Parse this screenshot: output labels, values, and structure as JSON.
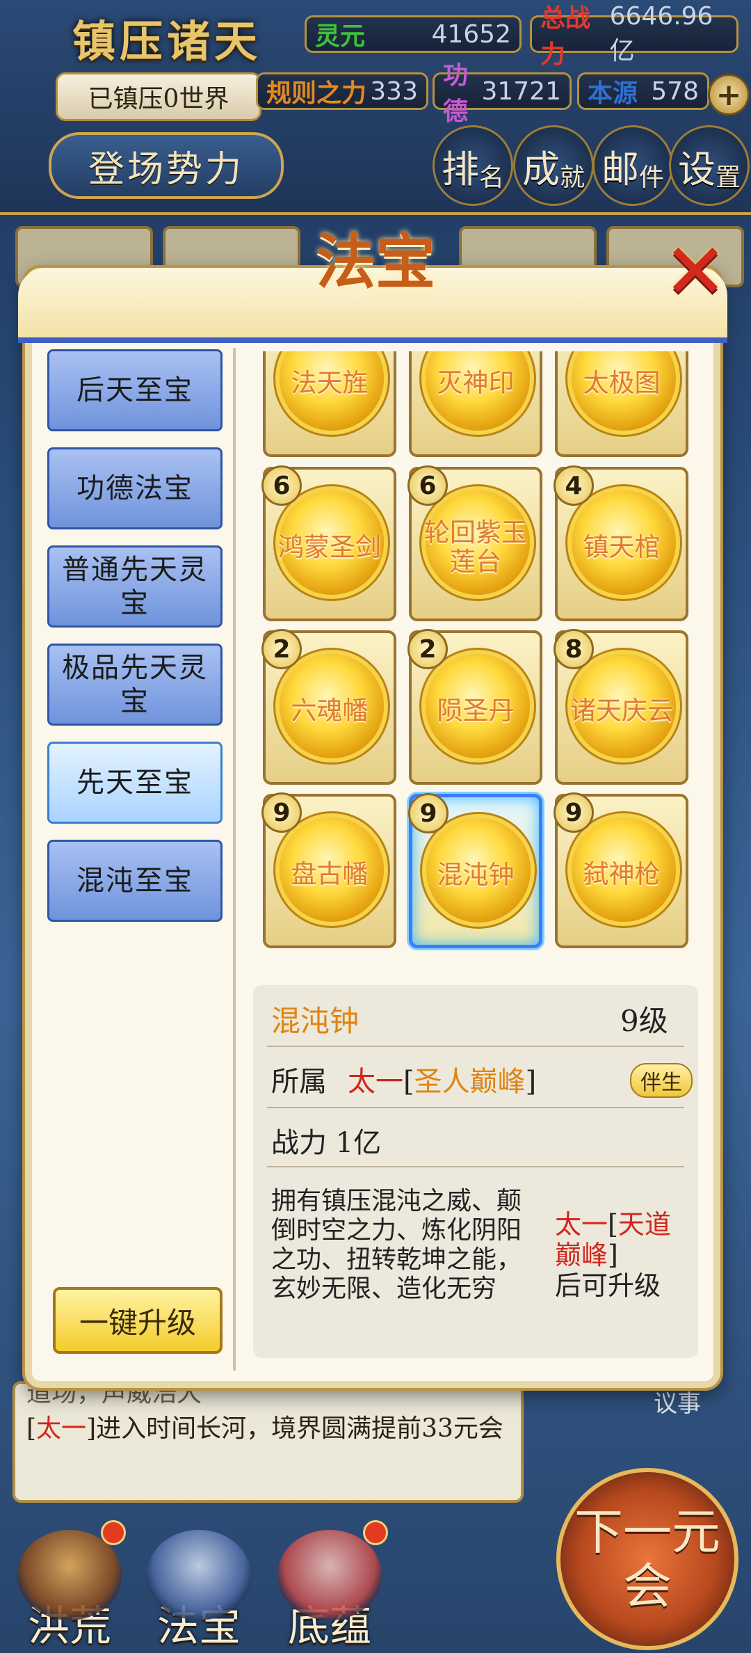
{
  "hud": {
    "title": "镇压诸天",
    "subtitle": "已镇压0世界",
    "faction_button": "登场势力",
    "resources": [
      {
        "label": "灵元",
        "value": "41652",
        "color": "#3fbf3f"
      },
      {
        "label": "总战力",
        "value": "6646.96亿",
        "color": "#e03a2a"
      },
      {
        "label": "规则之力",
        "value": "333",
        "color": "#e58a1f"
      },
      {
        "label": "功德",
        "value": "31721",
        "color": "#c85ad2"
      },
      {
        "label": "本源",
        "value": "578",
        "color": "#2f6fd8"
      }
    ],
    "plus": "+",
    "buttons": [
      {
        "main": "排",
        "sub": "名"
      },
      {
        "main": "成",
        "sub": "就"
      },
      {
        "main": "邮",
        "sub": "件"
      },
      {
        "main": "设",
        "sub": "置"
      }
    ]
  },
  "dialog": {
    "title": "法宝",
    "close": "✕",
    "categories": [
      "后天至宝",
      "功德法宝",
      "普通先天灵宝",
      "极品先天灵宝",
      "先天至宝",
      "混沌至宝"
    ],
    "active_category": "先天至宝",
    "one_key_upgrade": "一键升级",
    "treasures": [
      {
        "name": "法天旌",
        "level": null
      },
      {
        "name": "灭神印",
        "level": null
      },
      {
        "name": "太极图",
        "level": null
      },
      {
        "name": "鸿蒙圣剑",
        "level": "6"
      },
      {
        "name": "轮回紫玉莲台",
        "level": "6"
      },
      {
        "name": "镇天棺",
        "level": "4"
      },
      {
        "name": "六魂幡",
        "level": "2"
      },
      {
        "name": "陨圣丹",
        "level": "2"
      },
      {
        "name": "诸天庆云",
        "level": "8"
      },
      {
        "name": "盘古幡",
        "level": "9"
      },
      {
        "name": "混沌钟",
        "level": "9"
      },
      {
        "name": "弑神枪",
        "level": "9"
      }
    ],
    "selected": {
      "name": "混沌钟",
      "level": "9级",
      "belong_label": "所属",
      "owner": "太一",
      "owner_rank": "圣人巅峰",
      "bond_tag": "伴生",
      "power_label": "战力",
      "power": "1亿",
      "description": "拥有镇压混沌之威、颠倒时空之力、炼化阴阳之功、扭转乾坤之能，玄妙无限、造化无穷",
      "req_owner": "太一",
      "req_rank": "天道巅峰",
      "req_suffix": "后可升级"
    }
  },
  "log": {
    "line_partial": "道场，声威浩大",
    "owner": "太一",
    "line_text": "进入时间长河，境界圆满提前33元会"
  },
  "side_tag": "议事",
  "nav": {
    "items": [
      "洪荒",
      "法宝",
      "底蕴"
    ],
    "next_button": "下一元会"
  }
}
